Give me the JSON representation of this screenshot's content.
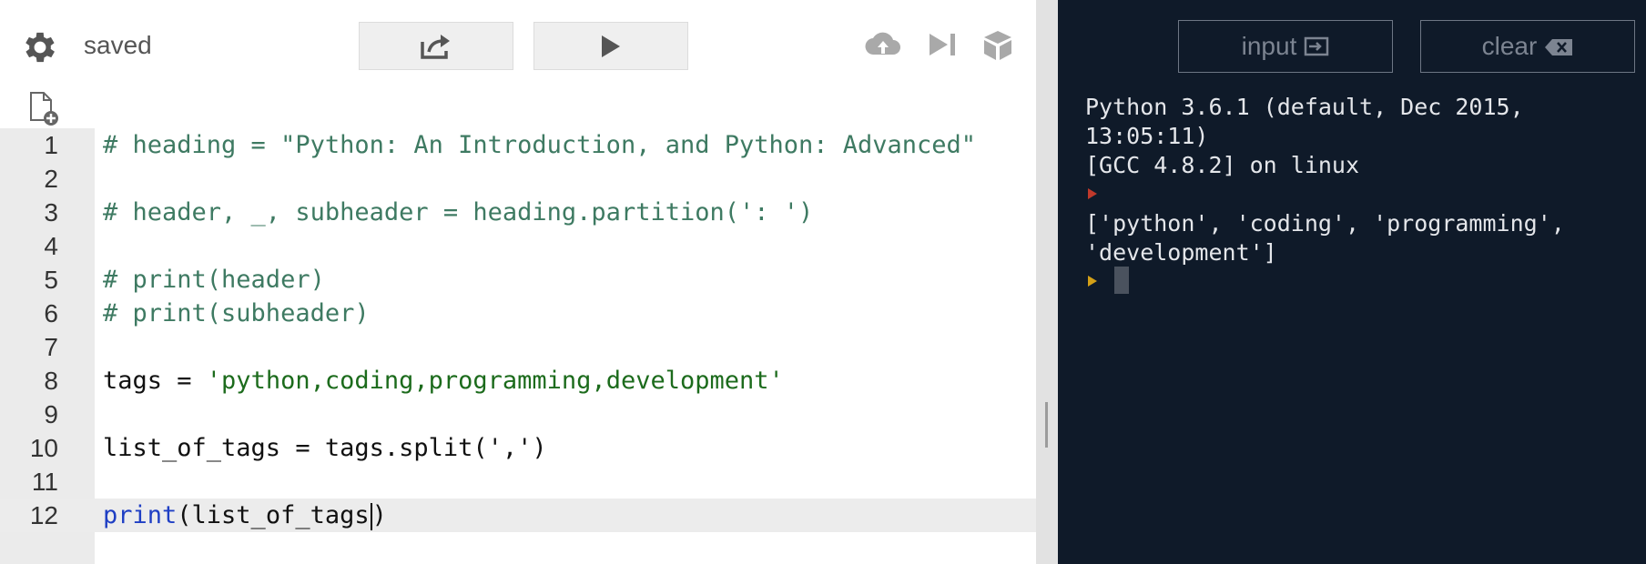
{
  "toolbar": {
    "status": "saved",
    "share_icon": "share-icon",
    "run_icon": "play-icon"
  },
  "code_lines": [
    {
      "n": "1",
      "text": "# heading = \"Python: An Introduction, and Python: Advanced\""
    },
    {
      "n": "2",
      "text": ""
    },
    {
      "n": "3",
      "text": "# header, _, subheader = heading.partition(': ')"
    },
    {
      "n": "4",
      "text": ""
    },
    {
      "n": "5",
      "text": "# print(header)"
    },
    {
      "n": "6",
      "text": "# print(subheader)"
    },
    {
      "n": "7",
      "text": ""
    },
    {
      "n": "8",
      "text": "tags = 'python,coding,programming,development'"
    },
    {
      "n": "9",
      "text": ""
    },
    {
      "n": "10",
      "text": "list_of_tags = tags.split(',')"
    },
    {
      "n": "11",
      "text": ""
    },
    {
      "n": "12",
      "text": "print(list_of_tags)"
    }
  ],
  "console": {
    "input_label": "input",
    "clear_label": "clear",
    "banner_line1": "Python 3.6.1 (default, Dec 2015,",
    "banner_line2": "13:05:11)",
    "banner_line3": "[GCC 4.8.2] on linux",
    "output_line1": "['python', 'coding', 'programming',",
    "output_line2": "'development']"
  },
  "colors": {
    "console_bg": "#0f1a29",
    "comment": "#3e7a62",
    "string": "#1c6b1c",
    "keyword": "#1f3fc4",
    "prompt_red": "#c0392b",
    "prompt_yellow": "#d4a017"
  }
}
